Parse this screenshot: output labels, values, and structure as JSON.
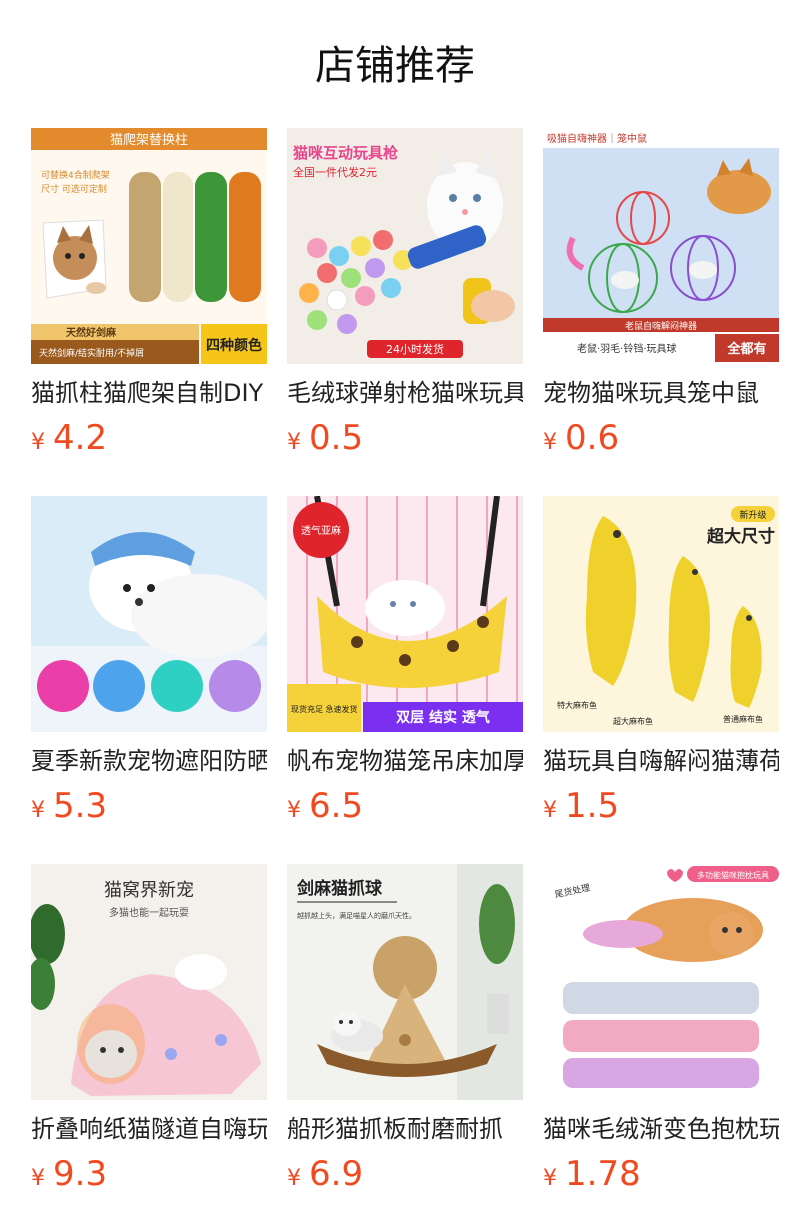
{
  "section_title": "店铺推荐",
  "currency_symbol": "¥",
  "products": [
    {
      "name": "猫抓柱猫爬架自制DIY",
      "price": "4.2",
      "image": {
        "banner": "猫爬架替换柱",
        "side1": "可替换4合制爬架",
        "side2": "尺寸 可选可定制",
        "strip": "天然好剑麻",
        "foot": "天然剑麻/结实耐用/不掉屑",
        "badge": "四种颜色"
      }
    },
    {
      "name": "毛绒球弹射枪猫咪玩具",
      "price": "0.5",
      "image": {
        "banner": "猫咪互动玩具枪",
        "sub": "全国一件代发2元",
        "foot": "24小时发货"
      }
    },
    {
      "name": "宠物猫咪玩具笼中鼠",
      "price": "0.6",
      "image": {
        "banner": "吸猫自嗨神器｜笼中鼠",
        "strip": "老鼠自嗨解闷神器",
        "foot": "老鼠·羽毛·铃铛·玩具球",
        "badge": "全都有"
      }
    },
    {
      "name": "夏季新款宠物遮阳防晒",
      "price": "5.3",
      "image": {}
    },
    {
      "name": "帆布宠物猫笼吊床加厚",
      "price": "6.5",
      "image": {
        "corner": "透气亚麻",
        "left": "现货充足 急速发货",
        "foot": "双层 结实 透气"
      }
    },
    {
      "name": "猫玩具自嗨解闷猫薄荷",
      "price": "1.5",
      "image": {
        "tag": "新升级",
        "head": "超大尺寸",
        "l1": "特大麻布鱼",
        "l2": "超大麻布鱼",
        "l3": "普通麻布鱼"
      }
    },
    {
      "name": "折叠响纸猫隧道自嗨玩具",
      "price": "9.3",
      "image": {
        "head": "猫窝界新宠",
        "sub": "多猫也能一起玩耍"
      }
    },
    {
      "name": "船形猫抓板耐磨耐抓",
      "price": "6.9",
      "image": {
        "head": "剑麻猫抓球",
        "sub": "越抓越上头，满足喵星人的磨爪天性。"
      }
    },
    {
      "name": "猫咪毛绒渐变色抱枕玩具",
      "price": "1.78",
      "image": {
        "tag": "多功能猫咪抱枕玩具",
        "note": "尾货处理"
      }
    }
  ]
}
